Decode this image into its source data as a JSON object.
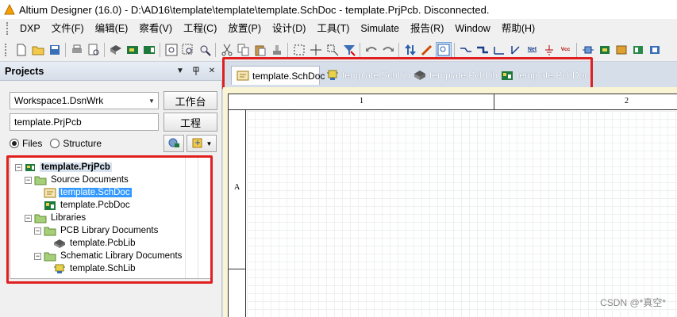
{
  "window": {
    "title": "Altium Designer (16.0) - D:\\AD16\\template\\template\\template.SchDoc - template.PrjPcb. Disconnected."
  },
  "menu": [
    "DXP",
    "文件(F)",
    "编辑(E)",
    "察看(V)",
    "工程(C)",
    "放置(P)",
    "设计(D)",
    "工具(T)",
    "Simulate",
    "报告(R)",
    "Window",
    "帮助(H)"
  ],
  "panel": {
    "title": "Projects",
    "workspace_value": "Workspace1.DsnWrk",
    "workspace_button": "工作台",
    "project_value": "template.PrjPcb",
    "project_button": "工程",
    "view_modes": {
      "files": "Files",
      "structure": "Structure",
      "selected": "files"
    }
  },
  "tree": {
    "items": [
      {
        "label": "template.PrjPcb",
        "level": 0,
        "kind": "project",
        "expanded": true,
        "selected": false,
        "root": true
      },
      {
        "label": "Source Documents",
        "level": 1,
        "kind": "folder",
        "expanded": true,
        "selected": false
      },
      {
        "label": "template.SchDoc",
        "level": 2,
        "kind": "schdoc",
        "selected": true
      },
      {
        "label": "template.PcbDoc",
        "level": 2,
        "kind": "pcbdoc",
        "selected": false
      },
      {
        "label": "Libraries",
        "level": 1,
        "kind": "folder",
        "expanded": true,
        "selected": false
      },
      {
        "label": "PCB Library Documents",
        "level": 2,
        "kind": "folder",
        "expanded": true,
        "selected": false
      },
      {
        "label": "template.PcbLib",
        "level": 3,
        "kind": "pcblib",
        "selected": false
      },
      {
        "label": "Schematic Library Documents",
        "level": 2,
        "kind": "folder",
        "expanded": true,
        "selected": false
      },
      {
        "label": "template.SchLib",
        "level": 3,
        "kind": "schlib",
        "selected": false
      }
    ]
  },
  "doc_tabs": [
    {
      "label": "template.SchDoc",
      "kind": "schdoc",
      "active": true
    },
    {
      "label": "template.SchLib",
      "kind": "schlib",
      "active": false
    },
    {
      "label": "template.PcbLib",
      "kind": "pcblib",
      "active": false
    },
    {
      "label": "template.PcbDoc",
      "kind": "pcbdoc",
      "active": false
    }
  ],
  "sheet": {
    "zone_columns": [
      "1",
      "2"
    ],
    "zone_rows": [
      "A"
    ]
  },
  "toolbar": {
    "net_label": "Net",
    "vcc_label": "Vcc"
  },
  "watermark": "CSDN @*真空*",
  "colors": {
    "highlight_box": "#e02020",
    "selection": "#3399ff",
    "sheet_background": "#f9f4d4"
  }
}
